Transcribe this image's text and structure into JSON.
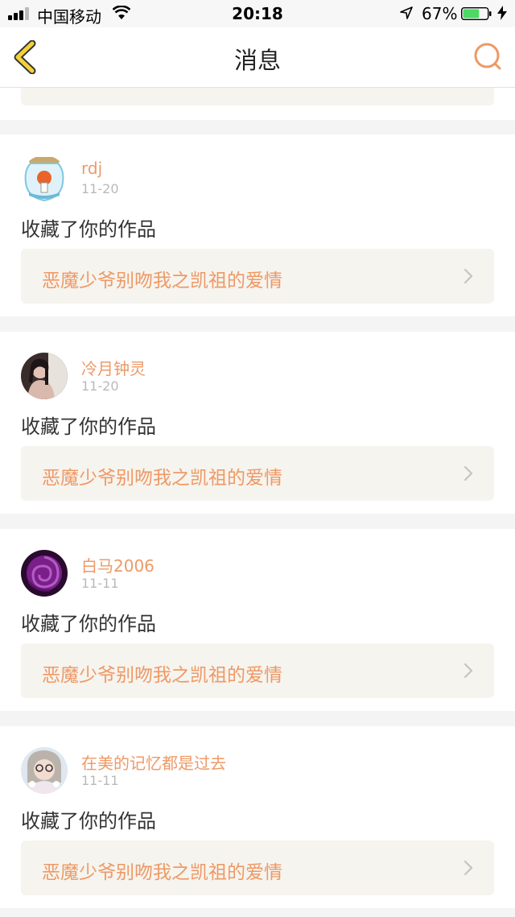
{
  "status_bar": {
    "carrier": "中国移动",
    "time": "20:18",
    "battery_percent": "67%",
    "battery_level": 0.67
  },
  "nav": {
    "title": "消息",
    "back_icon": "chevron-left-icon",
    "search_icon": "search-icon"
  },
  "colors": {
    "accent": "#ee9966",
    "link_bg": "#f6f4ee",
    "page_bg": "#f4f4f4"
  },
  "messages": [
    {
      "user": "rdj",
      "time": "11-20",
      "text": "收藏了你的作品",
      "work": "恶魔少爷别吻我之凯祖的爱情"
    },
    {
      "user": "冷月钟灵",
      "time": "11-20",
      "text": "收藏了你的作品",
      "work": "恶魔少爷别吻我之凯祖的爱情"
    },
    {
      "user": "白马2006",
      "time": "11-11",
      "text": "收藏了你的作品",
      "work": "恶魔少爷别吻我之凯祖的爱情"
    },
    {
      "user": "在美的记忆都是过去",
      "time": "11-11",
      "text": "收藏了你的作品",
      "work": "恶魔少爷别吻我之凯祖的爱情"
    }
  ]
}
